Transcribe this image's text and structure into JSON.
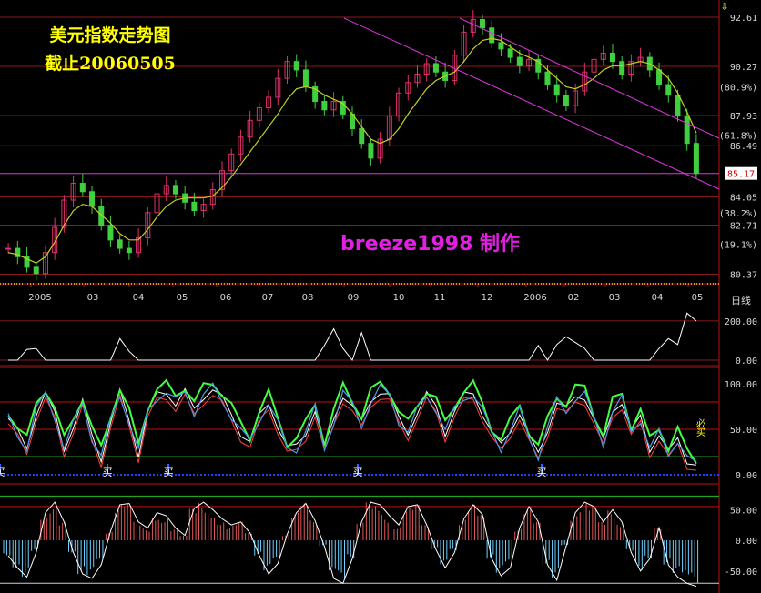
{
  "title": {
    "line1": "美元指数走势图",
    "line2": "截止20060505"
  },
  "credit": "breeze1998 制作",
  "period_label": "日线",
  "colors": {
    "background": "#000000",
    "grid": "#8a1a1a",
    "up": "#e0306b",
    "down": "#3fcf3f",
    "trendline": "#e036e0",
    "axis_text": "#d8d8d8",
    "buy_marker": "#ffffff",
    "hist_up": "#e05a5a",
    "hist_down": "#6fd0ff"
  },
  "chart_data": [
    {
      "type": "candlestick",
      "name": "main",
      "x_tick_labels": [
        "2005",
        "03",
        "04",
        "05",
        "06",
        "07",
        "08",
        "09",
        "10",
        "11",
        "12",
        "2006",
        "02",
        "03",
        "04",
        "05"
      ],
      "y_tick_labels": [
        "92.61",
        "90.27",
        "87.93",
        "86.49",
        "84.05",
        "82.71",
        "80.37"
      ],
      "fib_labels": [
        "(80.9%)",
        "(61.8%)",
        "(38.2%)",
        "(19.1%)"
      ],
      "last_price_label": "85.17",
      "ylim": [
        80.0,
        93.0
      ],
      "closes": [
        81.6,
        81.2,
        80.7,
        80.4,
        81.4,
        82.6,
        83.9,
        84.7,
        84.3,
        83.6,
        82.7,
        82.0,
        81.6,
        81.4,
        82.1,
        83.3,
        84.2,
        84.6,
        84.2,
        83.8,
        83.4,
        83.7,
        84.4,
        85.3,
        86.1,
        86.9,
        87.7,
        88.3,
        88.8,
        89.7,
        90.5,
        90.1,
        89.3,
        88.6,
        88.2,
        88.6,
        88.0,
        87.3,
        86.6,
        85.9,
        86.8,
        87.9,
        89.0,
        89.5,
        89.9,
        90.4,
        90.0,
        89.6,
        90.8,
        91.9,
        92.5,
        92.1,
        91.4,
        91.1,
        90.7,
        90.3,
        90.6,
        90.0,
        89.4,
        88.9,
        88.4,
        89.1,
        90.0,
        90.6,
        90.9,
        90.5,
        89.9,
        90.5,
        90.7,
        90.1,
        89.4,
        88.9,
        87.9,
        86.6,
        85.17
      ],
      "ma": [
        81.4,
        81.3,
        81.1,
        80.9,
        81.2,
        81.9,
        82.7,
        83.4,
        83.7,
        83.6,
        83.2,
        82.8,
        82.3,
        82.0,
        82.0,
        82.5,
        83.1,
        83.6,
        83.9,
        84.0,
        84.0,
        84.0,
        84.1,
        84.5,
        85.0,
        85.6,
        86.2,
        86.8,
        87.4,
        88.0,
        88.7,
        89.2,
        89.3,
        89.2,
        88.9,
        88.7,
        88.5,
        88.0,
        87.4,
        86.8,
        86.6,
        86.8,
        87.3,
        88.0,
        88.6,
        89.2,
        89.6,
        89.8,
        90.0,
        90.5,
        91.1,
        91.5,
        91.6,
        91.5,
        91.2,
        90.9,
        90.7,
        90.5,
        90.1,
        89.7,
        89.3,
        89.2,
        89.4,
        89.7,
        90.1,
        90.3,
        90.3,
        90.4,
        90.5,
        90.4,
        90.1,
        89.7,
        89.0,
        88.1,
        87.1
      ],
      "trendlines": "two parallel descending lines from Nov 2005 high plus horizontal line at 85.17"
    },
    {
      "type": "line",
      "name": "volume-like indicator",
      "y_tick_labels": [
        "200.00",
        "0.00"
      ],
      "ylim": [
        0,
        260
      ],
      "values": [
        0,
        0,
        55,
        60,
        0,
        0,
        0,
        0,
        0,
        0,
        0,
        0,
        110,
        45,
        0,
        0,
        0,
        0,
        0,
        0,
        0,
        0,
        0,
        0,
        0,
        0,
        0,
        0,
        0,
        0,
        0,
        0,
        0,
        0,
        75,
        160,
        60,
        0,
        140,
        0,
        0,
        0,
        0,
        0,
        0,
        0,
        0,
        0,
        0,
        0,
        0,
        0,
        0,
        0,
        0,
        0,
        0,
        75,
        0,
        80,
        120,
        90,
        60,
        0,
        0,
        0,
        0,
        0,
        0,
        0,
        60,
        110,
        80,
        240,
        200
      ]
    },
    {
      "type": "line",
      "name": "stochastic",
      "y_tick_labels": [
        "100.00",
        "50.00",
        "0.00"
      ],
      "ylim": [
        0,
        110
      ],
      "values": [
        62,
        45,
        30,
        70,
        88,
        65,
        30,
        55,
        78,
        42,
        20,
        58,
        88,
        60,
        25,
        68,
        86,
        92,
        80,
        90,
        70,
        88,
        95,
        82,
        66,
        48,
        35,
        62,
        80,
        55,
        28,
        30,
        48,
        72,
        28,
        60,
        90,
        76,
        55,
        82,
        94,
        86,
        60,
        48,
        70,
        86,
        74,
        48,
        70,
        85,
        90,
        70,
        45,
        30,
        50,
        70,
        40,
        22,
        52,
        80,
        70,
        86,
        88,
        60,
        35,
        72,
        82,
        46,
        62,
        30,
        45,
        22,
        40,
        18,
        10
      ],
      "buy_labels": [
        "买",
        "买",
        "买",
        "买",
        "买"
      ],
      "sell_label": "必买"
    },
    {
      "type": "bar",
      "name": "oscillator histogram",
      "y_tick_labels": [
        "50.00",
        "0.00",
        "-50.00"
      ],
      "ylim": [
        -80,
        80
      ],
      "values": [
        -25,
        -45,
        -60,
        -20,
        45,
        62,
        30,
        -20,
        -55,
        -62,
        -40,
        15,
        58,
        60,
        30,
        20,
        45,
        40,
        20,
        8,
        52,
        62,
        50,
        35,
        25,
        30,
        12,
        -25,
        -55,
        -38,
        10,
        45,
        60,
        32,
        -10,
        -62,
        -70,
        -30,
        30,
        62,
        58,
        40,
        25,
        55,
        58,
        25,
        -15,
        -45,
        -20,
        35,
        58,
        42,
        -30,
        -58,
        -45,
        20,
        55,
        30,
        -40,
        -65,
        -10,
        45,
        62,
        55,
        30,
        50,
        30,
        -20,
        -50,
        -30,
        20,
        -40,
        -60,
        -70,
        -75
      ]
    }
  ]
}
